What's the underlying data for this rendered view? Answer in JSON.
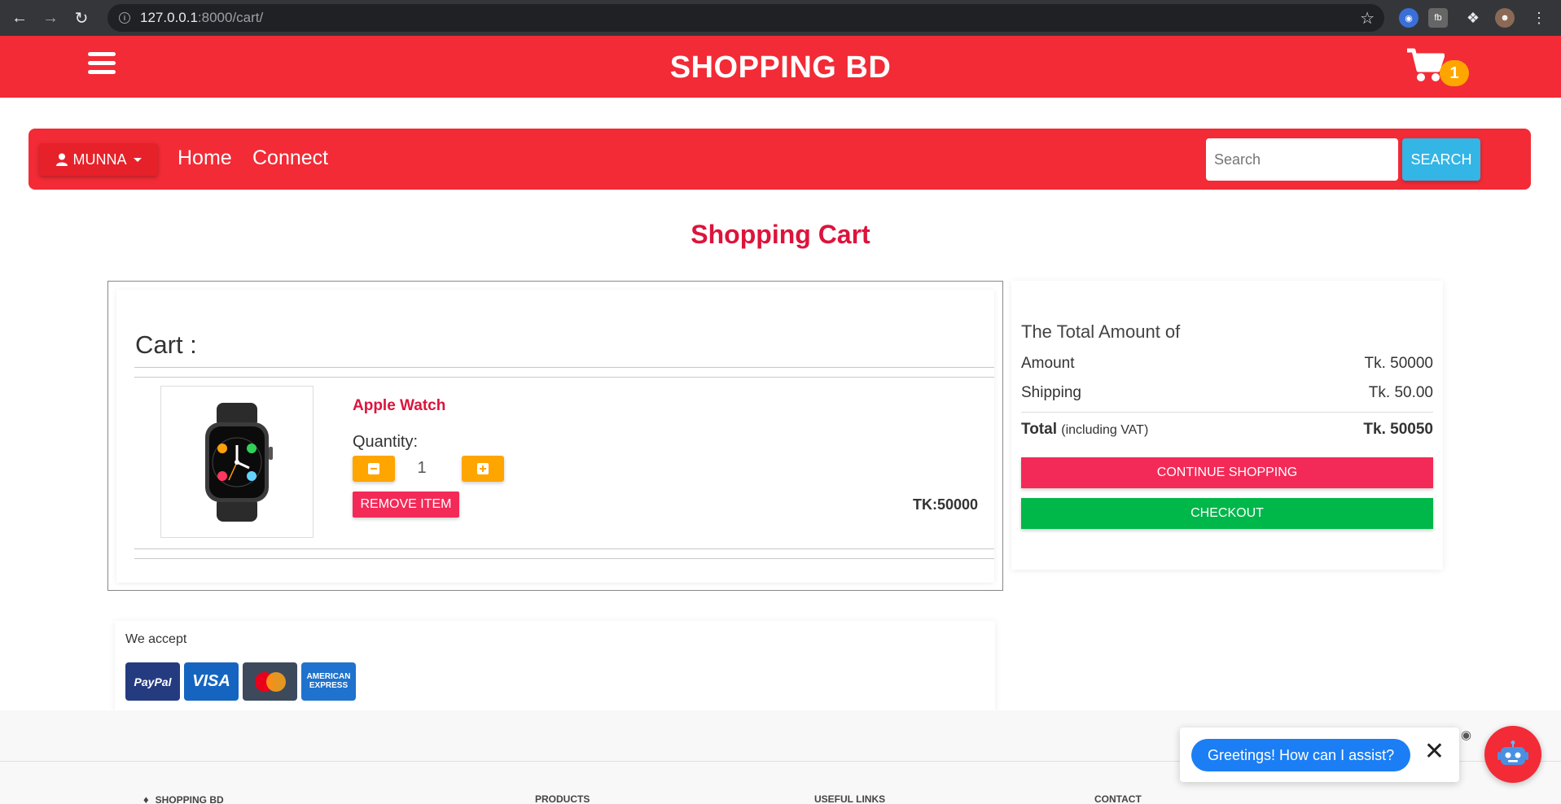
{
  "browser": {
    "url_host": "127.0.0.1",
    "url_path": ":8000/cart/"
  },
  "header": {
    "brand": "SHOPPING BD",
    "cart_count": "1"
  },
  "nav": {
    "user_label": "MUNNA",
    "links": [
      "Home",
      "Connect"
    ],
    "search_placeholder": "Search",
    "search_button": "SEARCH"
  },
  "page": {
    "title": "Shopping Cart"
  },
  "cart": {
    "heading": "Cart :",
    "item": {
      "name": "Apple Watch",
      "quantity_label": "Quantity:",
      "quantity": "1",
      "remove_label": "REMOVE ITEM",
      "price": "TK:50000"
    }
  },
  "summary": {
    "title": "The Total Amount of",
    "amount_label": "Amount",
    "amount_value": "Tk. 50000",
    "shipping_label": "Shipping",
    "shipping_value": "Tk. 50.00",
    "total_label": "Total",
    "total_note": "(including VAT)",
    "total_value": "Tk. 50050",
    "continue_label": "CONTINUE SHOPPING",
    "checkout_label": "CHECKOUT"
  },
  "payments": {
    "label": "We accept",
    "cards": [
      {
        "name": "PayPal",
        "color": "#253b80"
      },
      {
        "name": "VISA",
        "color": "#1565c0"
      },
      {
        "name": "mastercard",
        "color": "#3c4a5c"
      },
      {
        "name": "AMERICAN EXPRESS",
        "color": "#1f72cd"
      }
    ]
  },
  "footer": {
    "columns": [
      "SHOPPING BD",
      "PRODUCTS",
      "USEFUL LINKS",
      "CONTACT"
    ]
  },
  "chat": {
    "message": "Greetings! How can I assist?",
    "close": "✕"
  },
  "colors": {
    "primary_red": "#f22b36",
    "title_crimson": "#dc143c",
    "badge_orange": "#ffa500",
    "pink_btn": "#f32a57",
    "green_btn": "#00b74a",
    "search_blue": "#33b5e5"
  }
}
